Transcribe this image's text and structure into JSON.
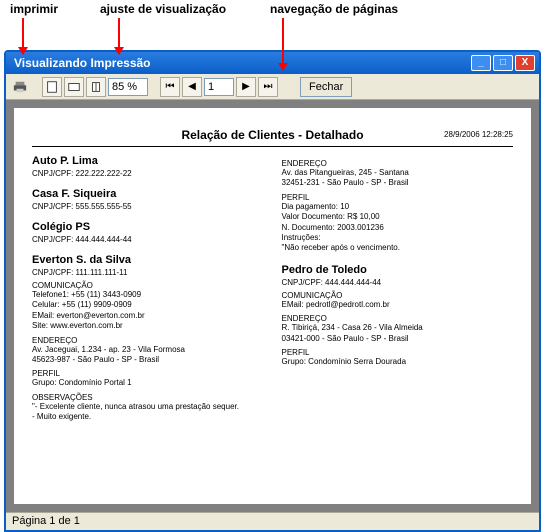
{
  "annotations": {
    "print": "imprimir",
    "view": "ajuste de visualização",
    "nav": "navegação de páginas"
  },
  "window": {
    "title": "Visualizando Impressão"
  },
  "toolbar": {
    "zoom_value": "85 %",
    "page_value": "1",
    "close_label": "Fechar"
  },
  "report": {
    "title": "Relação de Clientes - Detalhado",
    "datetime": "28/9/2006 12:28:25",
    "left": [
      {
        "name": "Auto P. Lima",
        "cnpj_label": "CNPJ/CPF:",
        "cnpj": "222.222.222-22"
      },
      {
        "name": "Casa F. Siqueira",
        "cnpj_label": "CNPJ/CPF:",
        "cnpj": "555.555.555-55"
      },
      {
        "name": "Colégio PS",
        "cnpj_label": "CNPJ/CPF:",
        "cnpj": "444.444.444-44"
      },
      {
        "name": "Everton S. da Silva",
        "cnpj_label": "CNPJ/CPF:",
        "cnpj": "111.111.111-11",
        "sections": [
          {
            "title": "COMUNICAÇÃO",
            "lines": [
              "Telefone1: +55 (11) 3443-0909",
              "Celular: +55 (11) 9909-0909",
              "EMail: everton@everton.com.br",
              "Site: www.everton.com.br"
            ]
          },
          {
            "title": "ENDEREÇO",
            "lines": [
              "Av. Jaceguai, 1.234 - ap. 23 - Vila Formosa",
              "45623-987 - São Paulo - SP - Brasil"
            ]
          },
          {
            "title": "PERFIL",
            "lines": [
              "Grupo: Condomínio Portal 1"
            ]
          },
          {
            "title": "OBSERVAÇÕES",
            "lines": [
              "\"- Excelente cliente, nunca atrasou uma prestação sequer.",
              "- Muito exigente."
            ]
          }
        ]
      }
    ],
    "right": [
      {
        "sections": [
          {
            "title": "ENDEREÇO",
            "lines": [
              "Av. das Pitangueiras, 245 - Santana",
              "32451-231 - São Paulo - SP - Brasil"
            ]
          },
          {
            "title": "PERFIL",
            "lines": [
              "Dia pagamento: 10",
              "Valor Documento: R$ 10,00",
              "N. Documento: 2003.001236",
              "Instruções:",
              "\"Não receber após o vencimento."
            ]
          }
        ]
      },
      {
        "name": "Pedro de Toledo",
        "cnpj_label": "CNPJ/CPF:",
        "cnpj": "444.444.444-44",
        "sections": [
          {
            "title": "COMUNICAÇÃO",
            "lines": [
              "EMail: pedrotl@pedrotl.com.br"
            ]
          },
          {
            "title": "ENDEREÇO",
            "lines": [
              "R. Tibiriçá, 234 - Casa 26 - Vila Almeida",
              "03421-000 - São Paulo - SP - Brasil"
            ]
          },
          {
            "title": "PERFIL",
            "lines": [
              "Grupo: Condomínio Serra Dourada"
            ]
          }
        ]
      }
    ]
  },
  "statusbar": {
    "text": "Página 1 de 1"
  }
}
